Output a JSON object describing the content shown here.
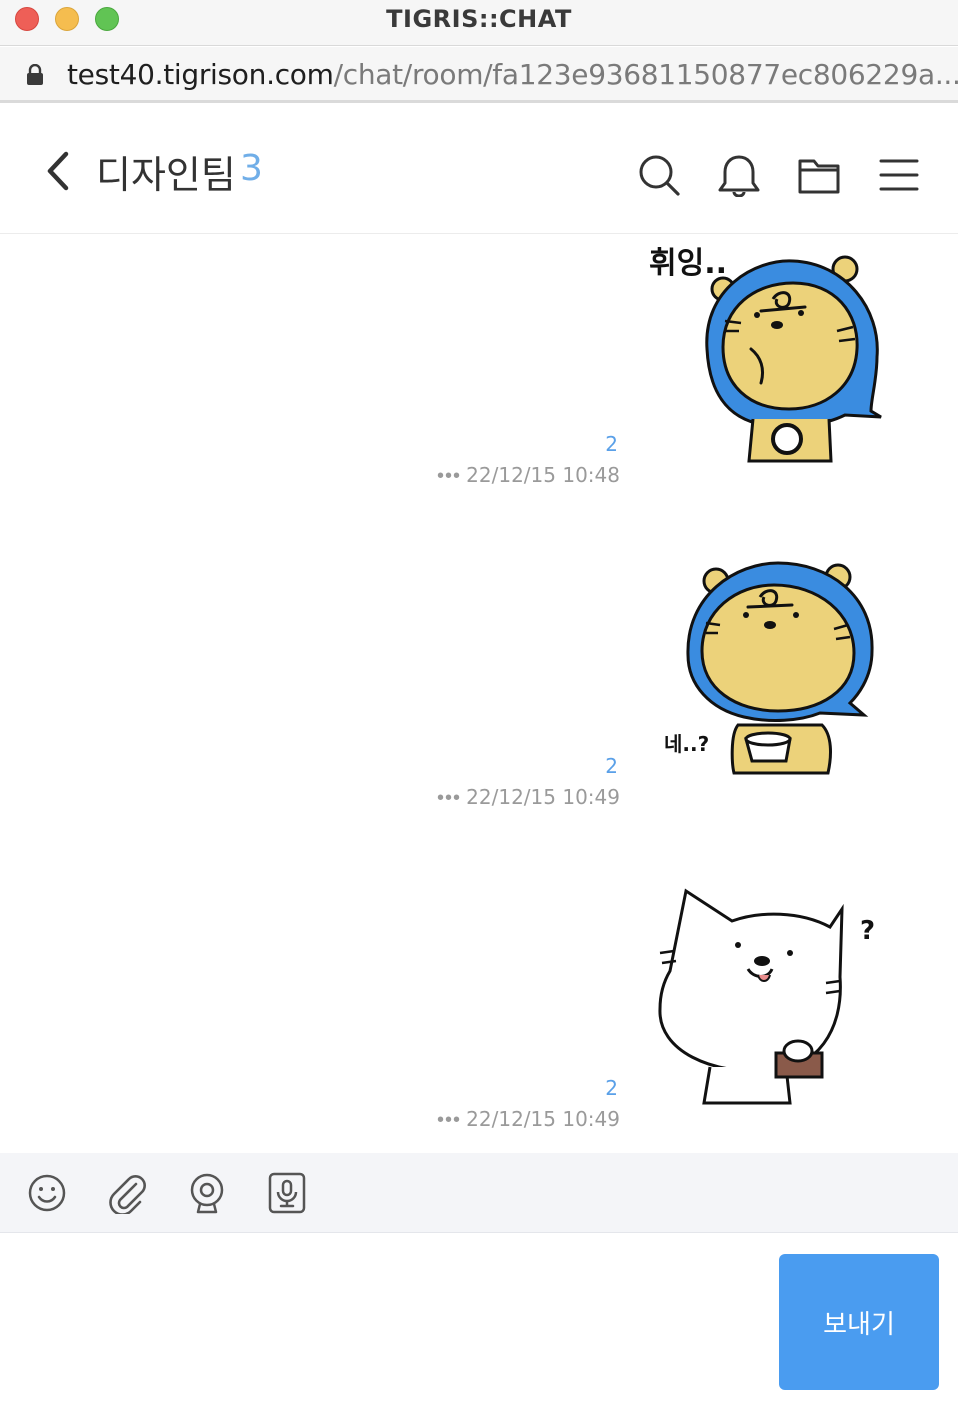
{
  "window": {
    "title": "TIGRIS::CHAT"
  },
  "urlbar": {
    "host": "test40.tigrison.com",
    "path": "/chat/room/fa123e93681150877ec806229a..."
  },
  "header": {
    "room_name": "디자인팀",
    "member_count": "3"
  },
  "messages": [
    {
      "unread": "2",
      "timestamp": "22/12/15 10:48",
      "more": "•••",
      "sticker": "tiger-sulking",
      "caption": "휘잉.."
    },
    {
      "unread": "2",
      "timestamp": "22/12/15 10:49",
      "more": "•••",
      "sticker": "tiger-with-cup",
      "caption": "네..?"
    },
    {
      "unread": "2",
      "timestamp": "22/12/15 10:49",
      "more": "•••",
      "sticker": "white-cat-question",
      "caption": "?"
    }
  ],
  "composer": {
    "value": "",
    "send_label": "보내기"
  },
  "colors": {
    "accent": "#4a9cf0",
    "count": "#70aee8",
    "unread": "#5aa0e8",
    "tiger": "#ecd27a",
    "hood": "#3a8ce0"
  }
}
